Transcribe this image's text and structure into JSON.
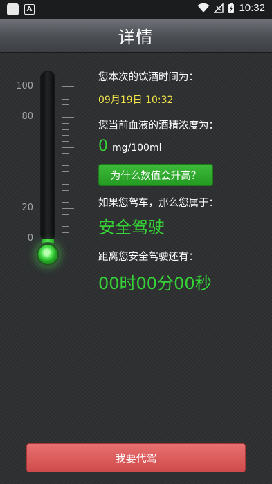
{
  "status_bar": {
    "time": "10:32",
    "notification_letter": "A"
  },
  "header": {
    "title": "详情"
  },
  "thermometer": {
    "scale_labels": [
      "100",
      "80",
      "20",
      "0"
    ],
    "level_fraction": 0.0
  },
  "details": {
    "drink_time_label": "您本次的饮酒时间为：",
    "drink_time_value": "09月19日 10:32",
    "concentration_label": "您当前血液的酒精浓度为：",
    "concentration_value": "0",
    "concentration_unit": "mg/100ml",
    "why_button": "为什么数值会升高？",
    "if_drive_label": "如果您驾车，那么您属于：",
    "driving_status": "安全驾驶",
    "countdown_label": "距离您安全驾驶还有：",
    "countdown_value": "00时00分00秒"
  },
  "actions": {
    "designated_driver": "我要代驾"
  },
  "colors": {
    "accent_green": "#36d336",
    "time_yellow": "#f4e54a",
    "button_red": "#d04b4b"
  }
}
